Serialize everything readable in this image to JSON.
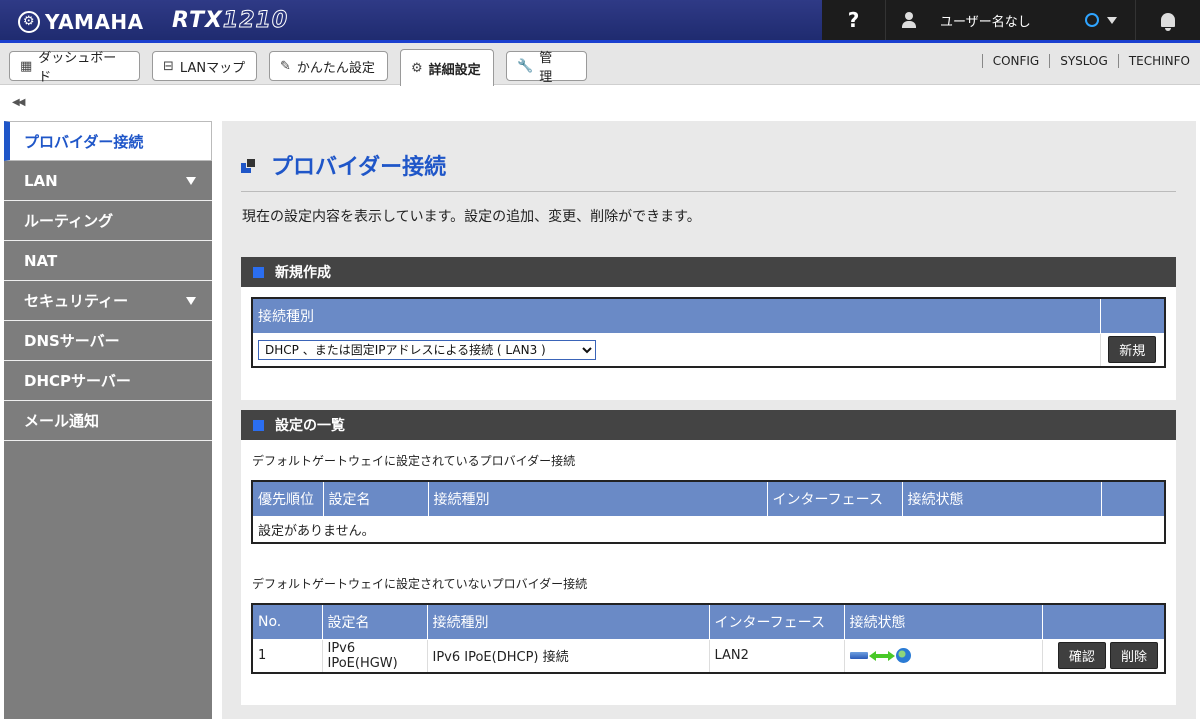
{
  "header": {
    "brand": "YAMAHA",
    "model_prefix": "RTX",
    "model_num": "1210",
    "help": "?",
    "user": "ユーザー名なし"
  },
  "tabs": [
    {
      "label": "ダッシュボード",
      "icon": "dashboard-icon"
    },
    {
      "label": "LANマップ",
      "icon": "lan-map-icon"
    },
    {
      "label": "かんたん設定",
      "icon": "wizard-icon"
    },
    {
      "label": "詳細設定",
      "icon": "gear-icon",
      "active": true
    },
    {
      "label": "管　理",
      "icon": "wrench-icon"
    }
  ],
  "toplinks": [
    "CONFIG",
    "SYSLOG",
    "TECHINFO"
  ],
  "collapse": "◀◀",
  "sidebar": {
    "items": [
      {
        "label": "プロバイダー接続",
        "active": true
      },
      {
        "label": "LAN",
        "expandable": true
      },
      {
        "label": "ルーティング"
      },
      {
        "label": "NAT"
      },
      {
        "label": "セキュリティー",
        "expandable": true
      },
      {
        "label": "DNSサーバー"
      },
      {
        "label": "DHCPサーバー"
      },
      {
        "label": "メール通知"
      }
    ]
  },
  "main": {
    "title": "プロバイダー接続",
    "description": "現在の設定内容を表示しています。設定の追加、変更、削除ができます。",
    "new_section": {
      "heading": "新規作成",
      "column": "接続種別",
      "selected": "DHCP 、または固定IPアドレスによる接続 ( LAN3 )",
      "new_button": "新規"
    },
    "list_section": {
      "heading": "設定の一覧",
      "default_caption": "デフォルトゲートウェイに設定されているプロバイダー接続",
      "default_columns": [
        "優先順位",
        "設定名",
        "接続種別",
        "インターフェース",
        "接続状態"
      ],
      "default_empty": "設定がありません。",
      "other_caption": "デフォルトゲートウェイに設定されていないプロバイダー接続",
      "other_columns": [
        "No.",
        "設定名",
        "接続種別",
        "インターフェース",
        "接続状態"
      ],
      "rows": [
        {
          "no": "1",
          "name": "IPv6 IPoE(HGW)",
          "type": "IPv6 IPoE(DHCP) 接続",
          "interface": "LAN2",
          "confirm": "確認",
          "delete": "削除"
        }
      ]
    }
  },
  "colors": {
    "accent": "#1f56c8",
    "header_bg": "#2f3a86",
    "table_header": "#6a8ac6",
    "sidebar_bg": "#7d7d7d"
  }
}
